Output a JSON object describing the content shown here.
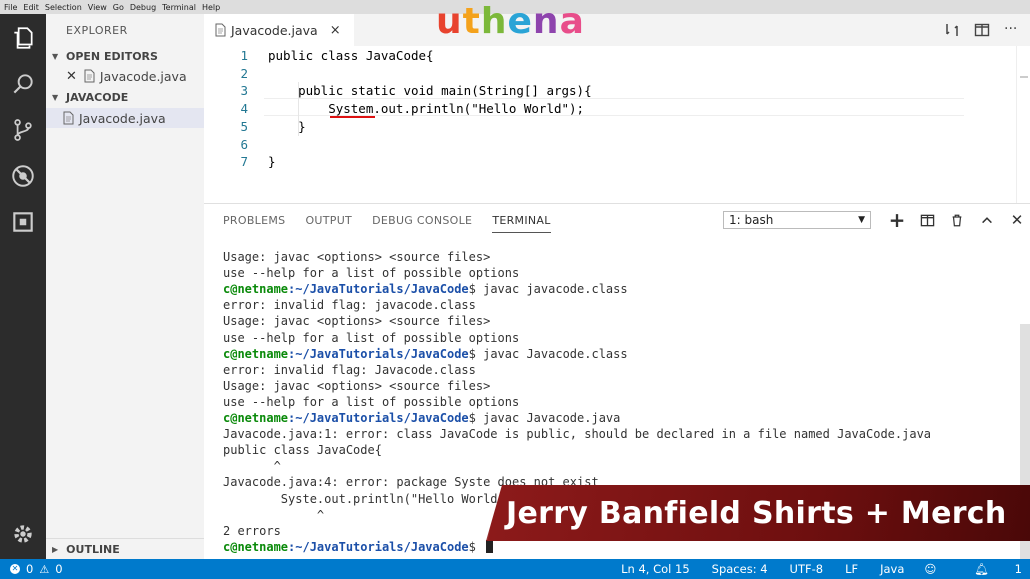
{
  "menu": [
    "File",
    "Edit",
    "Selection",
    "View",
    "Go",
    "Debug",
    "Terminal",
    "Help"
  ],
  "sidebar": {
    "title": "EXPLORER",
    "open_editors_label": "OPEN EDITORS",
    "open_editor_file": "Javacode.java",
    "folder_label": "JAVACODE",
    "folder_file": "Javacode.java",
    "outline_label": "OUTLINE"
  },
  "tab": {
    "label": "Javacode.java",
    "close": "×"
  },
  "logo": "uthena",
  "editor": {
    "line_numbers": [
      "1",
      "2",
      "3",
      "4",
      "5",
      "6",
      "7"
    ],
    "lines": [
      "public class JavaCode{",
      "",
      "    public static void main(String[] args){",
      "        System.out.println(\"Hello World\");",
      "    }",
      "",
      "}"
    ]
  },
  "panel": {
    "tabs": [
      "PROBLEMS",
      "OUTPUT",
      "DEBUG CONSOLE",
      "TERMINAL"
    ],
    "active_tab": "TERMINAL",
    "shell_select": "1: bash",
    "prompt_user": "c@netname",
    "prompt_path": ":~/JavaTutorials/JavaCode",
    "terminal": [
      {
        "text": "Usage: javac <options> <source files>"
      },
      {
        "text": "use --help for a list of possible options"
      },
      {
        "prompt": true,
        "text": "$ javac javacode.class"
      },
      {
        "text": "error: invalid flag: javacode.class"
      },
      {
        "text": "Usage: javac <options> <source files>"
      },
      {
        "text": "use --help for a list of possible options"
      },
      {
        "prompt": true,
        "text": "$ javac Javacode.class"
      },
      {
        "text": "error: invalid flag: Javacode.class"
      },
      {
        "text": "Usage: javac <options> <source files>"
      },
      {
        "text": "use --help for a list of possible options"
      },
      {
        "prompt": true,
        "text": "$ javac Javacode.java"
      },
      {
        "text": "Javacode.java:1: error: class JavaCode is public, should be declared in a file named JavaCode.java"
      },
      {
        "text": "public class JavaCode{"
      },
      {
        "text": "       ^"
      },
      {
        "text": "Javacode.java:4: error: package Syste does not exist"
      },
      {
        "text": "        Syste.out.println(\"Hello World\");"
      },
      {
        "text": "             ^"
      },
      {
        "text": "2 errors"
      },
      {
        "prompt": true,
        "text": "$ ",
        "cursor": true
      }
    ]
  },
  "banner": "Jerry Banfield Shirts + Merch",
  "status": {
    "errors": "0",
    "warnings": "0",
    "position": "Ln 4, Col 15",
    "spaces": "Spaces: 4",
    "encoding": "UTF-8",
    "eol": "LF",
    "language": "Java",
    "notifications": "1"
  },
  "colors": {
    "accent": "#007acc",
    "activity_bar": "#2c2c2c",
    "banner": "#7a1010",
    "logo_palette": [
      "#e8432e",
      "#f4a21c",
      "#7cb83a",
      "#2aa4d6",
      "#8e44ad",
      "#e84d8a"
    ]
  }
}
